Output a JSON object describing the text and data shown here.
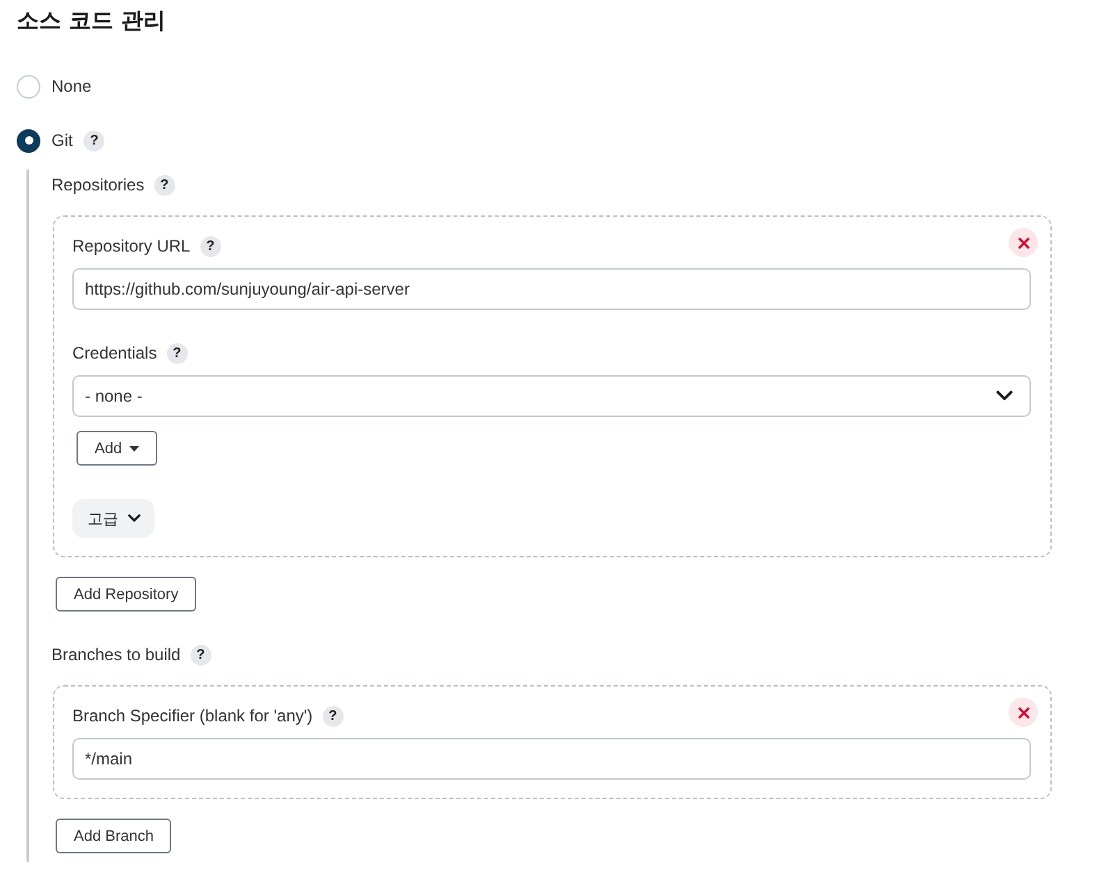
{
  "section": {
    "title": "소스 코드 관리"
  },
  "scm_options": [
    {
      "label": "None",
      "selected": false
    },
    {
      "label": "Git",
      "selected": true,
      "help": "?"
    }
  ],
  "repositories": {
    "label": "Repositories",
    "help": "?",
    "items": [
      {
        "fields": [
          {
            "kind": "text",
            "label": "Repository URL",
            "help": "?",
            "value": "https://github.com/sunjuyoung/air-api-server"
          },
          {
            "kind": "select",
            "label": "Credentials",
            "help": "?",
            "value": "- none -",
            "add_button": "Add"
          }
        ],
        "advanced_button": "고급"
      }
    ],
    "add_button": "Add Repository"
  },
  "branches": {
    "label": "Branches to build",
    "help": "?",
    "items": [
      {
        "fields": [
          {
            "kind": "text",
            "label": "Branch Specifier (blank for 'any')",
            "help": "?",
            "value": "*/main"
          }
        ]
      }
    ],
    "add_button": "Add Branch"
  }
}
